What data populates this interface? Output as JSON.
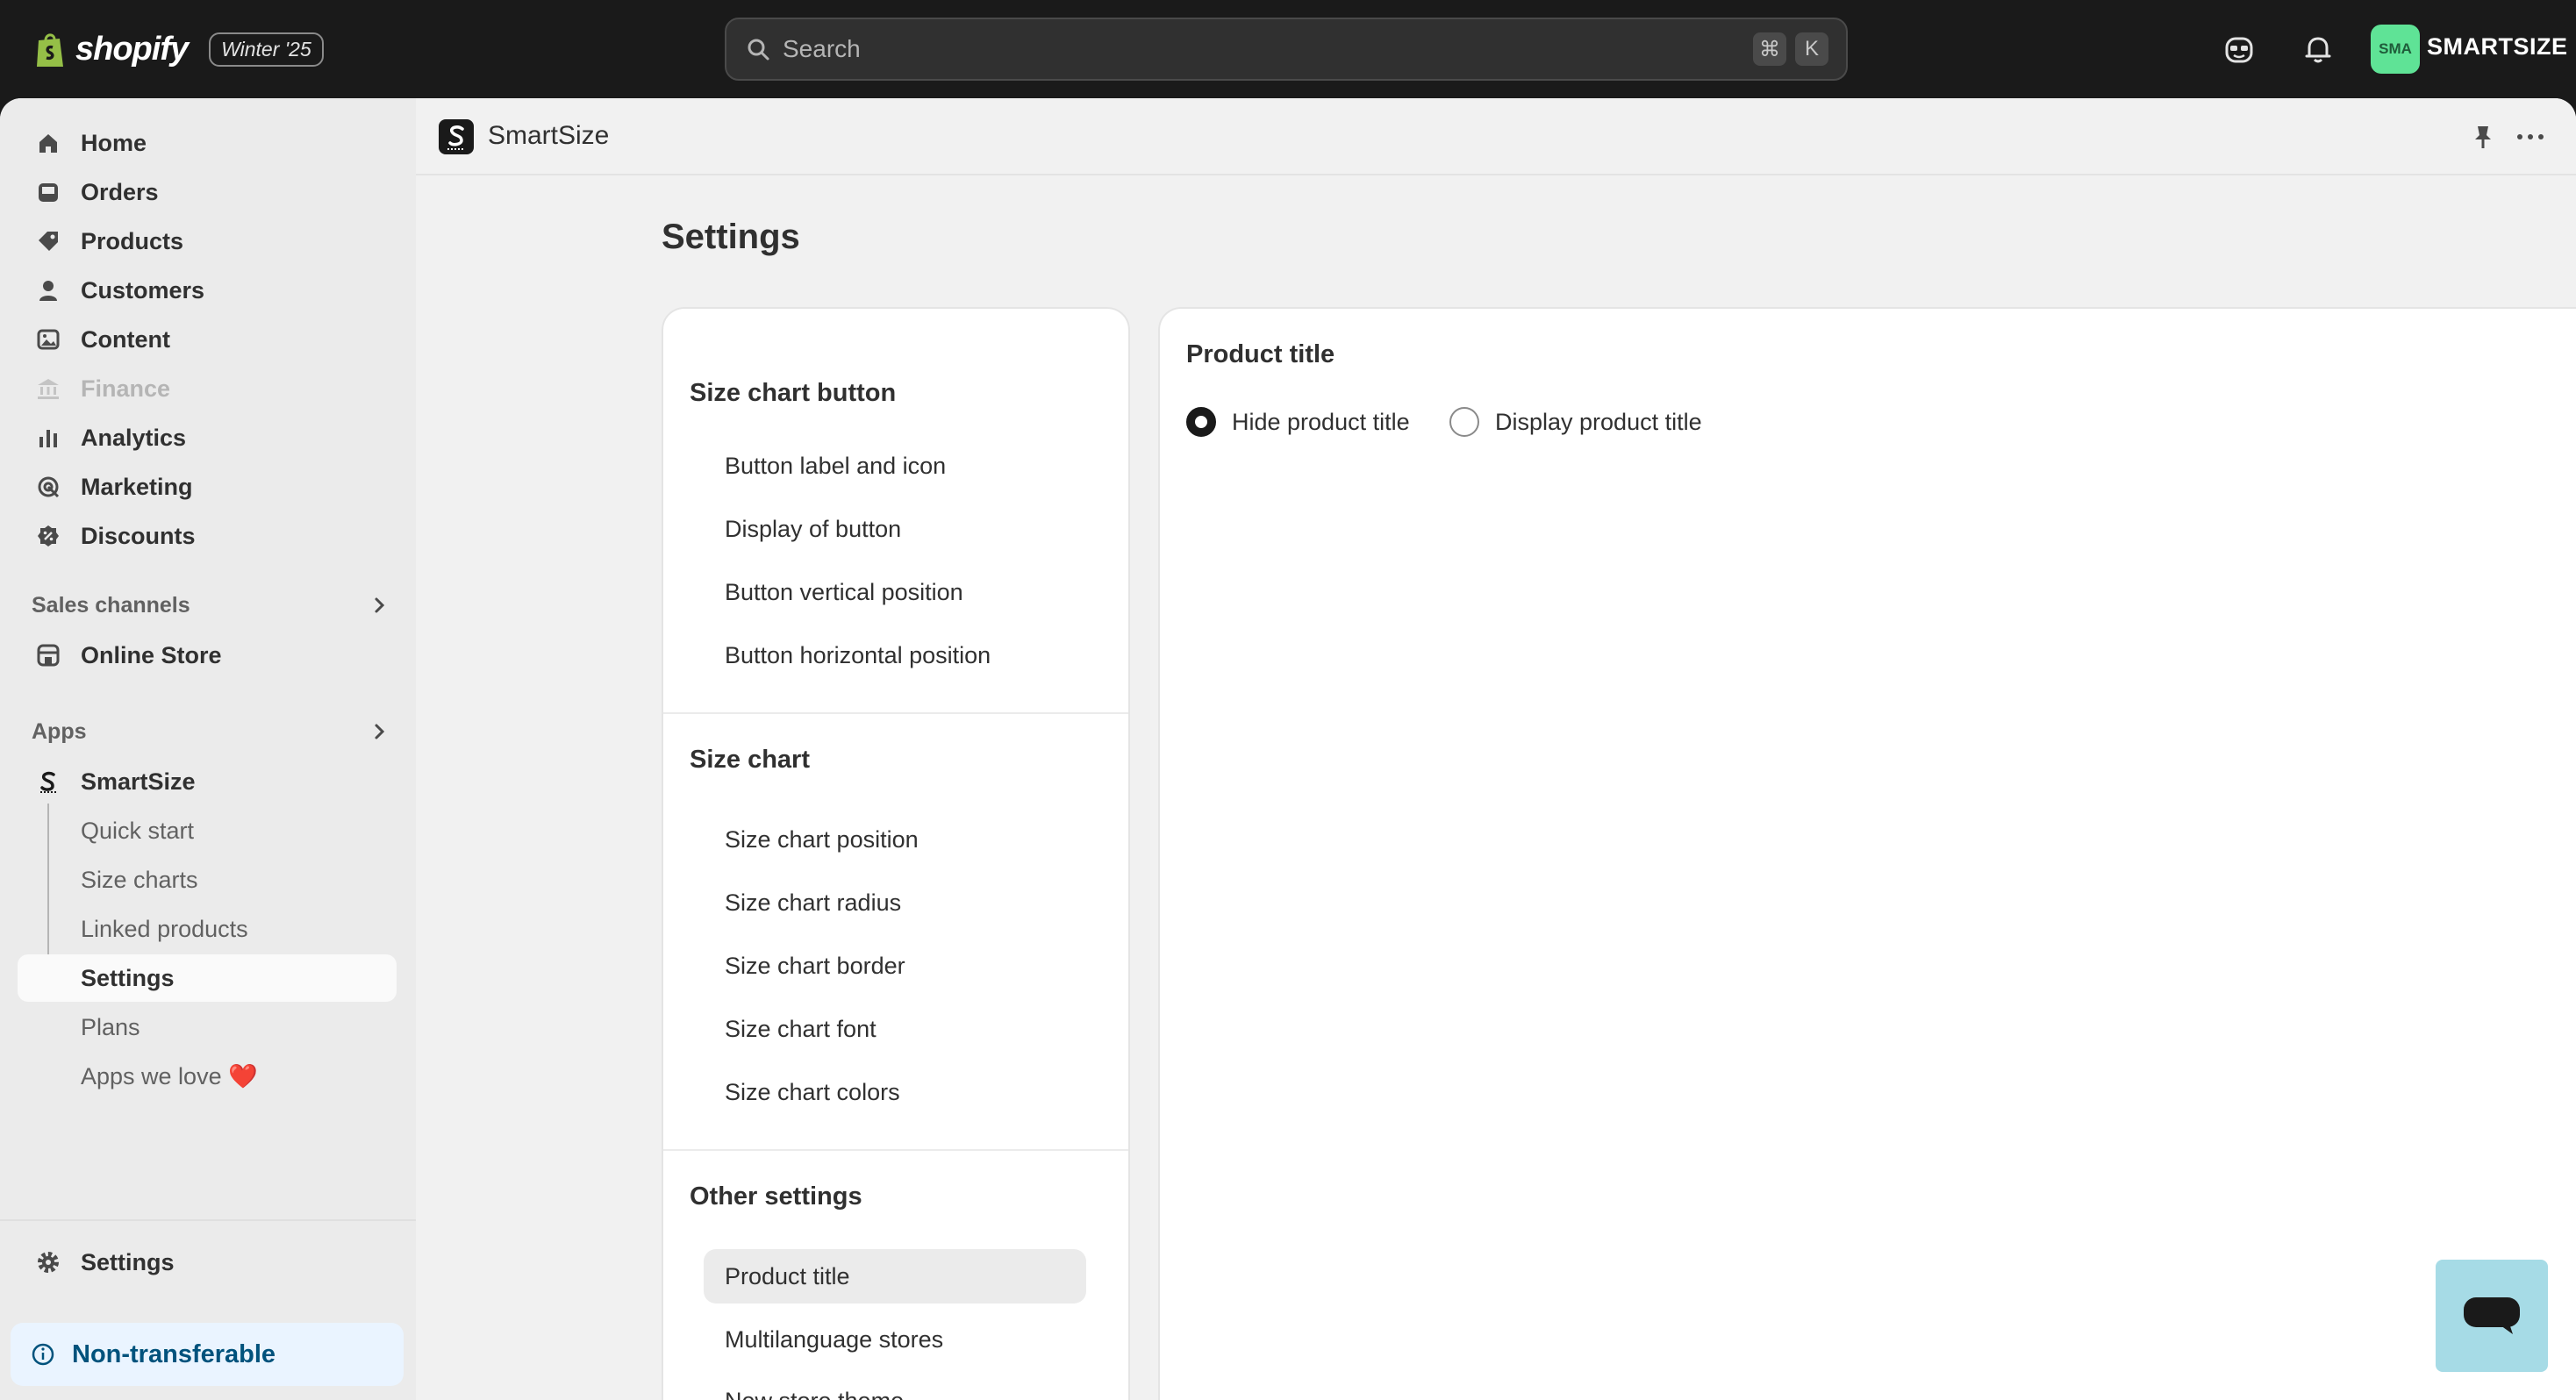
{
  "topbar": {
    "brand": "shopify",
    "edition": "Winter '25",
    "search_placeholder": "Search",
    "shortcut_keys": [
      "⌘",
      "K"
    ],
    "store_initials": "SMA",
    "store_name": "SMARTSIZE",
    "avatar_color": "#5fe396"
  },
  "sidebar": {
    "main_items": [
      {
        "label": "Home",
        "icon": "home-icon"
      },
      {
        "label": "Orders",
        "icon": "inbox-icon"
      },
      {
        "label": "Products",
        "icon": "tag-icon"
      },
      {
        "label": "Customers",
        "icon": "person-icon"
      },
      {
        "label": "Content",
        "icon": "image-icon"
      },
      {
        "label": "Finance",
        "icon": "bank-icon",
        "disabled": true
      },
      {
        "label": "Analytics",
        "icon": "bar-chart-icon"
      },
      {
        "label": "Marketing",
        "icon": "target-icon"
      },
      {
        "label": "Discounts",
        "icon": "discount-icon"
      }
    ],
    "sales_channels_label": "Sales channels",
    "online_store_label": "Online Store",
    "apps_label": "Apps",
    "app_name": "SmartSize",
    "app_subitems": [
      "Quick start",
      "Size charts",
      "Linked products",
      "Settings",
      "Plans",
      "Apps we love ❤️"
    ],
    "active_subitem": "Settings",
    "settings_label": "Settings",
    "nontransferable_label": "Non-transferable"
  },
  "app_header": {
    "title": "SmartSize"
  },
  "page": {
    "title": "Settings",
    "groups": [
      {
        "title": "Size chart button",
        "items": [
          "Button label and icon",
          "Display of button",
          "Button vertical position",
          "Button horizontal position"
        ]
      },
      {
        "title": "Size chart",
        "items": [
          "Size chart position",
          "Size chart radius",
          "Size chart border",
          "Size chart font",
          "Size chart colors"
        ]
      },
      {
        "title": "Other settings",
        "items": [
          "Product title",
          "Multilanguage stores",
          "New store theme"
        ]
      }
    ],
    "active_item": "Product title",
    "detail": {
      "title": "Product title",
      "options": [
        {
          "label": "Hide product title",
          "checked": true
        },
        {
          "label": "Display product title",
          "checked": false
        }
      ]
    }
  },
  "colors": {
    "topbar_bg": "#1a1a1a",
    "frame_bg": "#f1f1f1",
    "sidebar_bg": "#ebebeb",
    "info_bg": "#eaf4ff",
    "info_text": "#00527c",
    "chat_bg": "#a6dbe6"
  }
}
